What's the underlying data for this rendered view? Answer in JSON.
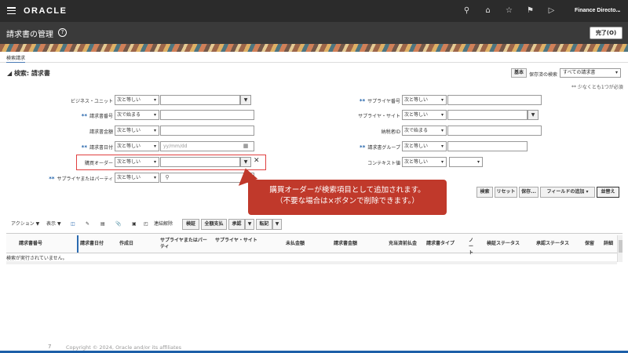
{
  "app": {
    "brand": "ORACLE",
    "user_menu": "Finance Directo...",
    "icons": [
      "search-icon",
      "home-icon",
      "star-icon",
      "flag-icon",
      "notifications-icon"
    ]
  },
  "page": {
    "title": "請求書の管理",
    "done_label": "完了(O)",
    "tab": "検索請求"
  },
  "search": {
    "header": "検索: 請求書",
    "basic_label": "基本",
    "saved_search_label": "保存済の検索",
    "saved_search_value": "すべての請求書",
    "required_note": "** 少なくとも1つが必須",
    "date_placeholder": "yy/mm/dd",
    "left_fields": [
      {
        "label": "ビジネス・ユニット",
        "required": false,
        "operator": "次と等しい"
      },
      {
        "label": "請求書番号",
        "required": true,
        "operator": "次で始まる"
      },
      {
        "label": "請求書金額",
        "required": false,
        "operator": "次と等しい"
      },
      {
        "label": "請求書日付",
        "required": true,
        "operator": "次と等しい"
      },
      {
        "label": "購買オーダー",
        "required": false,
        "operator": "次と等しい"
      },
      {
        "label": "サプライヤまたはパーティ",
        "required": true,
        "operator": "次と等しい"
      }
    ],
    "right_fields": [
      {
        "label": "サプライヤ番号",
        "required": true,
        "operator": "次と等しい"
      },
      {
        "label": "サプライヤ・サイト",
        "required": false,
        "operator": "次と等しい"
      },
      {
        "label": "納税者ID",
        "required": false,
        "operator": "次で始まる"
      },
      {
        "label": "請求書グループ",
        "required": true,
        "operator": "次と等しい"
      },
      {
        "label": "コンテキスト値",
        "required": false,
        "operator": "次と等しい"
      }
    ],
    "buttons": {
      "search": "検索",
      "reset": "リセット",
      "save": "保存...",
      "add_fields": "フィールドの追加",
      "reorder": "並替え"
    }
  },
  "callout": {
    "line1": "購買オーダーが検索項目として追加されます。",
    "line2": "（不要な場合は×ボタンで削除できます。）"
  },
  "results": {
    "toolbar": {
      "actions": "アクション",
      "view": "表示",
      "detach": "連結解除",
      "validate": "検証",
      "pay_in_full": "全額支払",
      "approve": "承認",
      "post": "転記"
    },
    "columns": [
      "請求書番号",
      "請求書日付",
      "作成日",
      "サプライヤまたはパーティ",
      "サプライヤ・サイト",
      "未払金額",
      "請求書金額",
      "充当済前払金",
      "請求書タイプ",
      "ノート",
      "検証ステータス",
      "承認ステータス",
      "保留",
      "詳細"
    ],
    "empty_message": "検索が実行されていません。"
  },
  "footer": {
    "page_number": "7",
    "copyright": "Copyright © 2024, Oracle and/or its affiliates"
  }
}
